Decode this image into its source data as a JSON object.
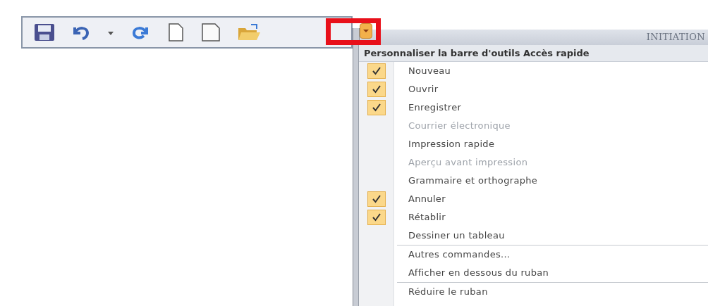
{
  "toolbar": {
    "buttons": [
      {
        "kind": "save"
      },
      {
        "kind": "undo"
      },
      {
        "kind": "dropdown"
      },
      {
        "kind": "redo"
      },
      {
        "kind": "new"
      },
      {
        "kind": "blank"
      },
      {
        "kind": "open"
      }
    ],
    "customize_button": {
      "highlighted": true
    }
  },
  "title_bar": {
    "title": "INITIATION"
  },
  "menu": {
    "title": "Personnaliser la barre d'outils Accès rapide",
    "groups": [
      [
        {
          "label": "Nouveau",
          "checked": true,
          "disabled": false
        },
        {
          "label": "Ouvrir",
          "checked": true,
          "disabled": false
        },
        {
          "label": "Enregistrer",
          "checked": true,
          "disabled": false
        },
        {
          "label": "Courrier électronique",
          "checked": false,
          "disabled": true
        },
        {
          "label": "Impression rapide",
          "checked": false,
          "disabled": false
        },
        {
          "label": "Aperçu avant impression",
          "checked": false,
          "disabled": true
        },
        {
          "label": "Grammaire et orthographe",
          "checked": false,
          "disabled": false
        },
        {
          "label": "Annuler",
          "checked": true,
          "disabled": false
        },
        {
          "label": "Rétablir",
          "checked": true,
          "disabled": false
        },
        {
          "label": "Dessiner un tableau",
          "checked": false,
          "disabled": false
        }
      ],
      [
        {
          "label": "Autres commandes...",
          "checked": false,
          "disabled": false
        },
        {
          "label": "Afficher en dessous du ruban",
          "checked": false,
          "disabled": false
        }
      ],
      [
        {
          "label": "Réduire le ruban",
          "checked": false,
          "disabled": false
        }
      ]
    ]
  }
}
